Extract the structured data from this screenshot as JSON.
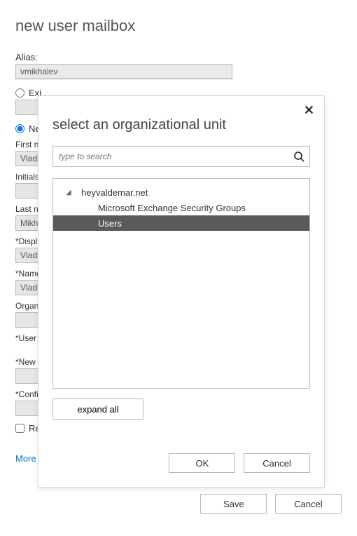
{
  "page": {
    "title": "new user mailbox"
  },
  "form": {
    "alias_label": "Alias:",
    "alias_value": "vmikhalev",
    "radio_existing": "Exi",
    "radio_new": "Ne",
    "first_name_label": "First na",
    "first_name_value": "Vladim",
    "initials_label": "Initials:",
    "initials_value": "",
    "last_name_label": "Last na",
    "last_name_value": "Mikhal",
    "display_label": "*Displa",
    "display_value": "Vladim",
    "name_label": "*Name",
    "name_value": "Vladim",
    "org_label": "Organi",
    "org_value": "",
    "user_logon_label": "*User l",
    "user_logon_value": "",
    "new_pw_label": "*New p",
    "new_pw_value": "",
    "confirm_label": "*Confir",
    "confirm_value": "",
    "require_pw_label": "Require password change on next logon",
    "more_link": "More options..."
  },
  "buttons": {
    "save": "Save",
    "cancel": "Cancel"
  },
  "modal": {
    "title": "select an organizational unit",
    "search_placeholder": "type to search",
    "tree_root": "heyvaldemar.net",
    "tree_child1": "Microsoft Exchange Security Groups",
    "tree_child2": "Users",
    "expand_all": "expand all",
    "ok": "OK",
    "cancel": "Cancel"
  }
}
